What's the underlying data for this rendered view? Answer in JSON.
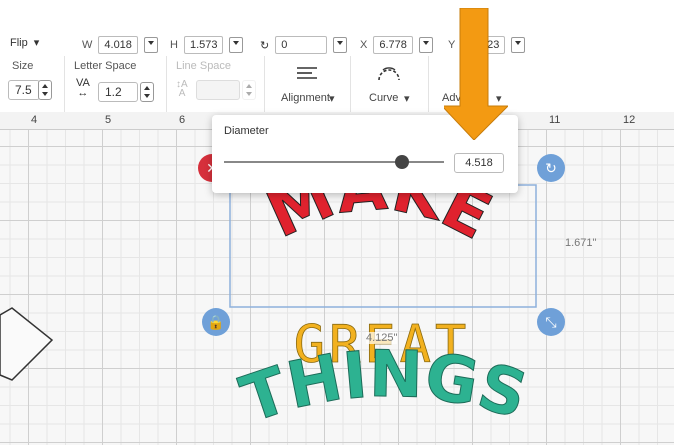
{
  "toolbar_top": {
    "flip_label": "Flip",
    "w_label": "W",
    "w_value": "4.018",
    "h_label": "H",
    "h_value": "1.573",
    "rotate_value": "0",
    "x_label": "X",
    "x_value": "6.778",
    "y_label": "Y",
    "y_value": "23"
  },
  "toolbar_text": {
    "size_label": "Size",
    "size_value": "7.5",
    "letter_space_label": "Letter Space",
    "letter_space_value": "1.2",
    "line_space_label": "Line Space",
    "alignment_label": "Alignment",
    "curve_label": "Curve",
    "advanced_label": "Adv"
  },
  "ruler": {
    "ticks": [
      "4",
      "5",
      "6",
      "11",
      "12"
    ]
  },
  "curve_panel": {
    "title": "Diameter",
    "value": "4.518",
    "slider_fraction": 0.81
  },
  "selection": {
    "height_label": "1.671\"",
    "width_label": "4.125\""
  },
  "artwork": {
    "line1": "MAKE",
    "line2": "GREAT",
    "line3": "THINGS"
  },
  "colors": {
    "red": "#e0222e",
    "yellow": "#f2b11f",
    "teal": "#2db291",
    "arrow": "#f39a12",
    "handle_blue": "#6fa0d8",
    "handle_red": "#d6303c"
  }
}
